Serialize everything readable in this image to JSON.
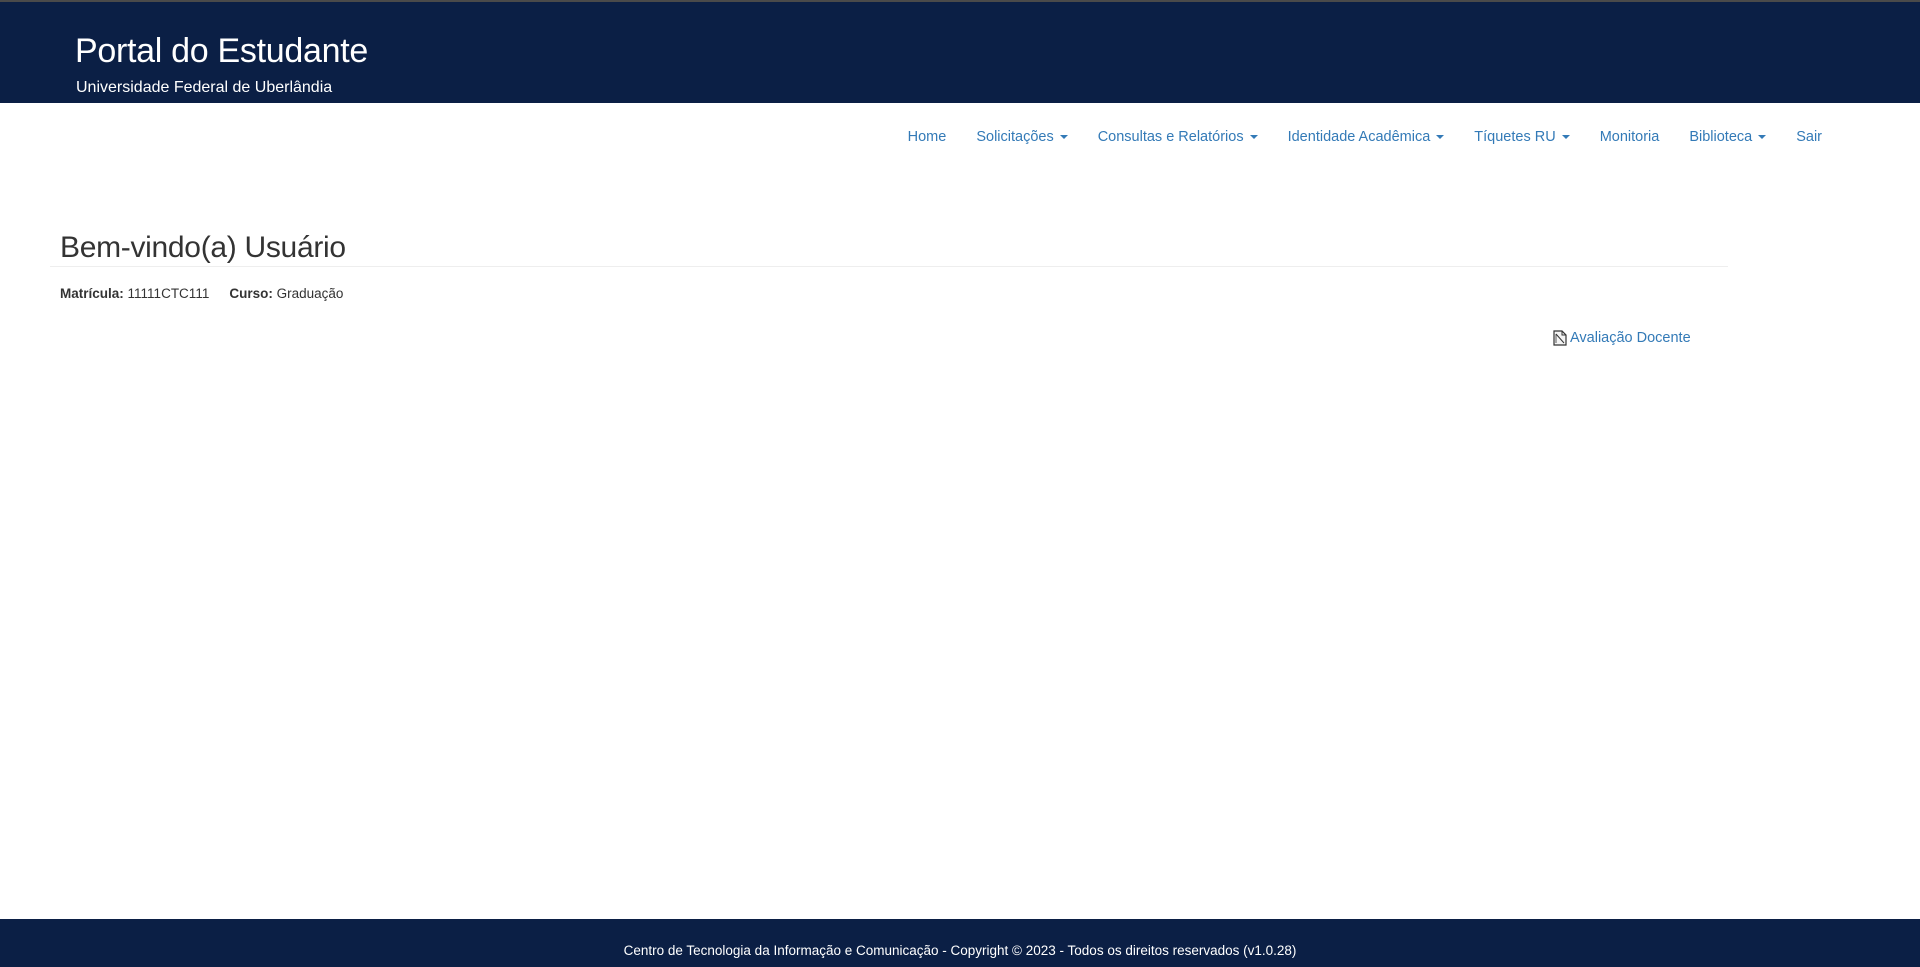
{
  "header": {
    "title": "Portal do Estudante",
    "subtitle": "Universidade Federal de Uberlândia"
  },
  "nav": {
    "items": [
      {
        "label": "Home",
        "dropdown": false
      },
      {
        "label": "Solicitações",
        "dropdown": true
      },
      {
        "label": "Consultas e Relatórios",
        "dropdown": true
      },
      {
        "label": "Identidade Acadêmica",
        "dropdown": true
      },
      {
        "label": "Tíquetes RU",
        "dropdown": true
      },
      {
        "label": "Monitoria",
        "dropdown": false
      },
      {
        "label": "Biblioteca",
        "dropdown": true
      },
      {
        "label": "Sair",
        "dropdown": false
      }
    ]
  },
  "main": {
    "welcome": "Bem-vindo(a) Usuário",
    "matricula_label": "Matrícula:",
    "matricula_value": "11111CTC111",
    "curso_label": "Curso:",
    "curso_value": "Graduação",
    "avaliacao_link": "Avaliação Docente",
    "avaliacao_icon": "document-icon"
  },
  "footer": {
    "text": "Centro de Tecnologia da Informação e Comunicação - Copyright © 2023 - Todos os direitos reservados (v1.0.28)"
  },
  "colors": {
    "header_bg": "#0b1f45",
    "link": "#337ab7",
    "text": "#333333"
  }
}
